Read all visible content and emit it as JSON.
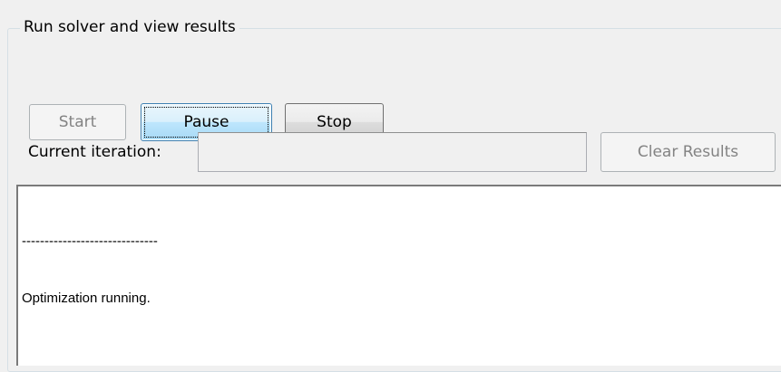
{
  "panel": {
    "title": "Run solver and view results"
  },
  "buttons": {
    "start_label": "Start",
    "pause_label": "Pause",
    "stop_label": "Stop",
    "clear_label": "Clear Results"
  },
  "iteration": {
    "label": "Current iteration:",
    "value": ""
  },
  "output": {
    "lines": [
      "------------------------------",
      "Optimization running."
    ]
  }
}
